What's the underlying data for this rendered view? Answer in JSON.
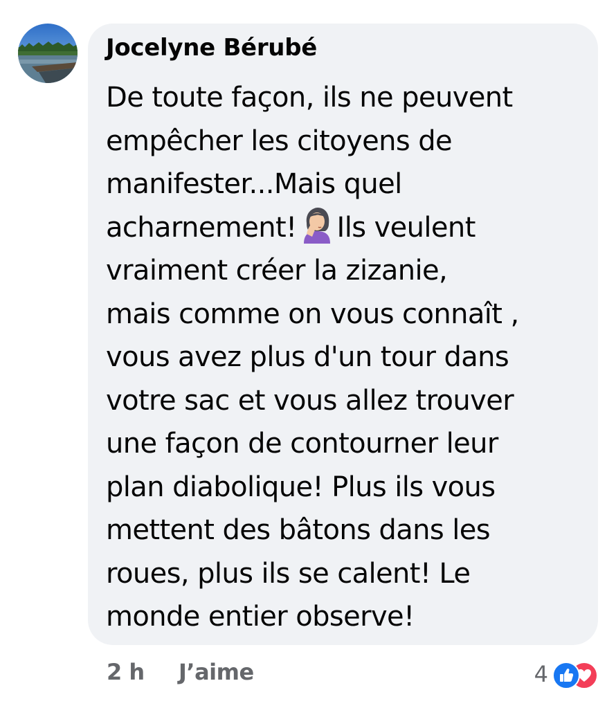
{
  "comment": {
    "author": "Jocelyne Bérubé",
    "avatar_icon": "profile-photo-lake-landscape",
    "text_lines": [
      "De toute façon, ils ne peuvent",
      "empêcher les citoyens de",
      "manifester...Mais quel",
      "acharnement!",
      "Ils veulent",
      "vraiment créer la zizanie,",
      "mais comme on vous connaît ,",
      "vous avez plus d'un tour dans",
      "votre sac et vous allez trouver",
      "une façon de contourner leur",
      "plan diabolique! Plus ils vous",
      "mettent des bâtons dans les",
      "roues, plus ils se calent! Le",
      "monde entier observe!"
    ],
    "inline_emoji": "woman-facepalming-emoji"
  },
  "footer": {
    "timestamp": "2 h",
    "like_label": "J’aime",
    "reaction_count": "4",
    "reaction_icons": [
      "like-reaction-icon",
      "love-reaction-icon"
    ]
  },
  "colors": {
    "bubble_bg": "#f0f2f5",
    "text": "#050505",
    "meta_text": "#65676b",
    "like_blue": "#1877f2",
    "love_red": "#f33e58"
  }
}
